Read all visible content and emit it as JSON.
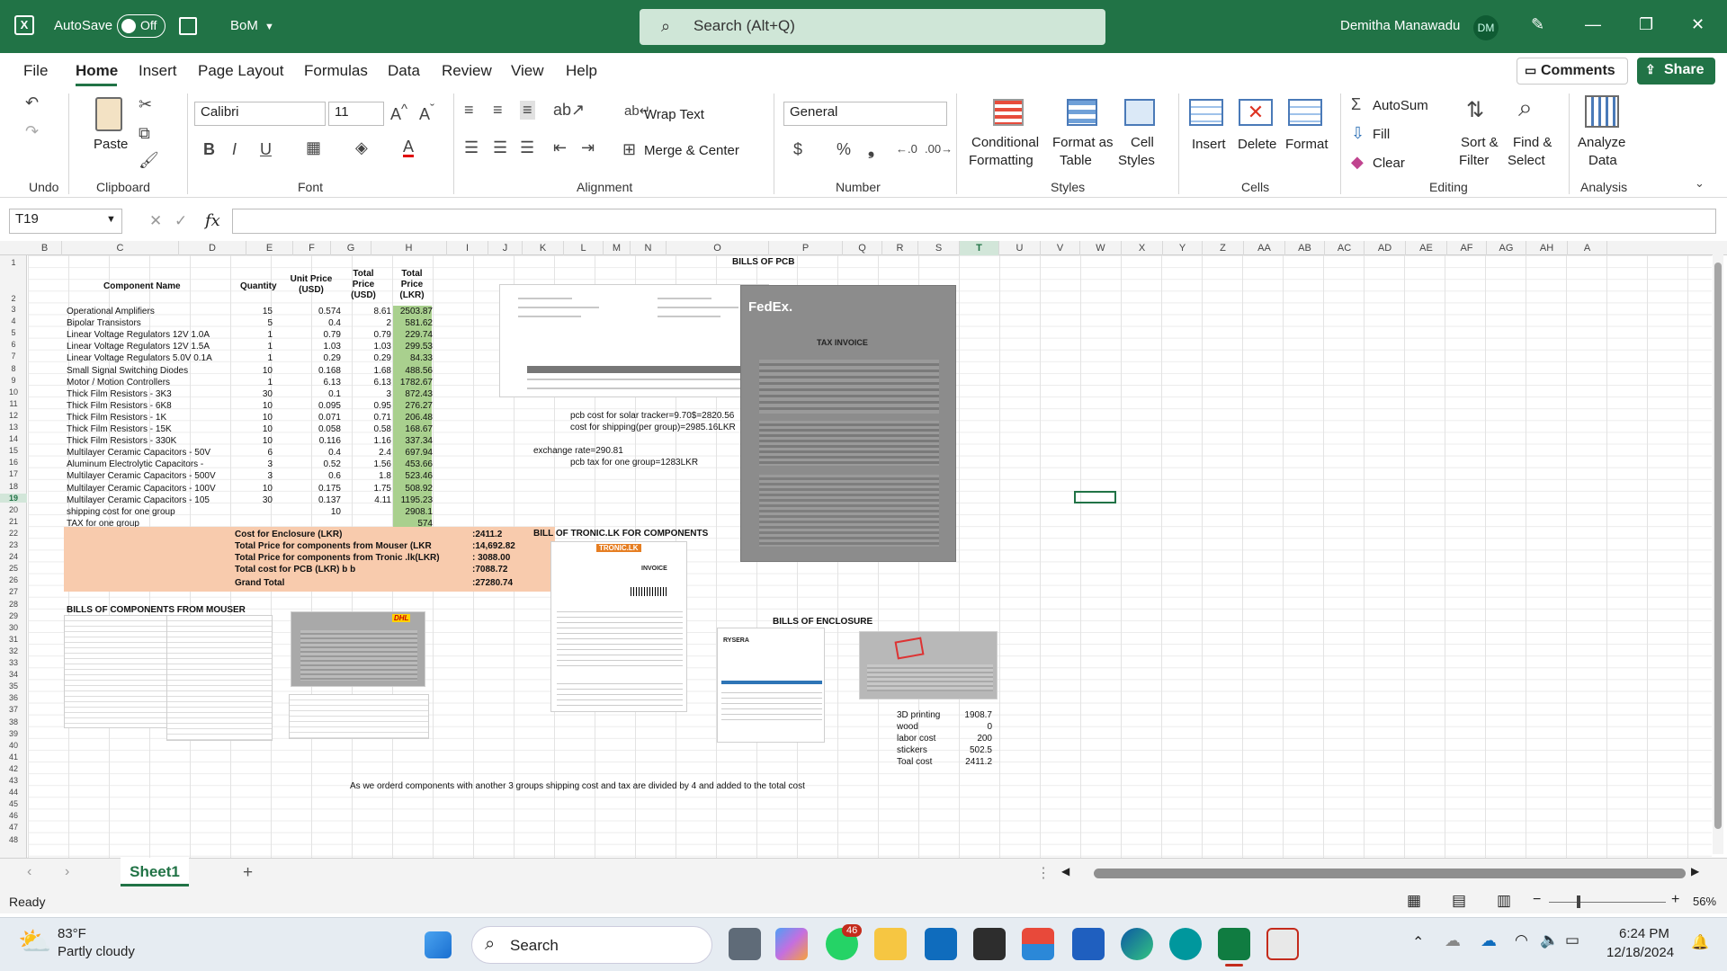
{
  "titlebar": {
    "autosave": "AutoSave",
    "autosave_state": "Off",
    "doc_name": "BoM",
    "search_placeholder": "Search (Alt+Q)",
    "user_name": "Demitha Manawadu",
    "user_initials": "DM"
  },
  "menu": {
    "file": "File",
    "home": "Home",
    "insert": "Insert",
    "page_layout": "Page Layout",
    "formulas": "Formulas",
    "data": "Data",
    "review": "Review",
    "view": "View",
    "help": "Help",
    "comments": "Comments",
    "share": "Share"
  },
  "ribbon": {
    "undo_group": "Undo",
    "paste": "Paste",
    "clipboard_group": "Clipboard",
    "font_name": "Calibri",
    "font_size": "11",
    "font_group": "Font",
    "wrap_text": "Wrap Text",
    "merge_center": "Merge & Center",
    "alignment_group": "Alignment",
    "number_format": "General",
    "number_group": "Number",
    "conditional_formatting": [
      "Conditional",
      "Formatting"
    ],
    "format_as_table": [
      "Format as",
      "Table"
    ],
    "cell_styles": [
      "Cell",
      "Styles"
    ],
    "styles_group": "Styles",
    "insert": "Insert",
    "delete": "Delete",
    "format": "Format",
    "cells_group": "Cells",
    "autosum": "AutoSum",
    "fill": "Fill",
    "clear": "Clear",
    "sort_filter": [
      "Sort &",
      "Filter"
    ],
    "find_select": [
      "Find &",
      "Select"
    ],
    "editing_group": "Editing",
    "analyze_data": [
      "Analyze",
      "Data"
    ],
    "analysis_group": "Analysis"
  },
  "formula_bar": {
    "name_box": "T19",
    "fx": "fx",
    "content": ""
  },
  "columns": [
    "B",
    "C",
    "D",
    "E",
    "F",
    "G",
    "H",
    "I",
    "J",
    "K",
    "L",
    "M",
    "N",
    "O",
    "P",
    "Q",
    "R",
    "S",
    "T",
    "U",
    "V",
    "W",
    "X",
    "Y",
    "Z",
    "AA",
    "AB",
    "AC",
    "AD",
    "AE",
    "AF",
    "AG",
    "AH",
    "A"
  ],
  "rows": [
    "1",
    "2",
    "3",
    "4",
    "5",
    "6",
    "7",
    "8",
    "9",
    "10",
    "11",
    "12",
    "13",
    "14",
    "15",
    "16",
    "17",
    "18",
    "19",
    "20",
    "21",
    "22",
    "23",
    "24",
    "25",
    "26",
    "27",
    "28",
    "29",
    "30",
    "31",
    "32",
    "33",
    "34",
    "35",
    "36",
    "37",
    "38",
    "39",
    "40",
    "41",
    "42",
    "43",
    "44",
    "45",
    "46",
    "47",
    "48"
  ],
  "sheet": {
    "title_pcb": "BILLS OF PCB",
    "headers": {
      "component": "Component Name",
      "quantity": "Quantity",
      "unit_price": "Unit Price (USD)",
      "total_usd": "Total Price (USD)",
      "total_lkr": "Total Price (LKR)"
    },
    "items": [
      {
        "name": "Operational Amplifiers",
        "qty": "15",
        "unit": "0.574",
        "usd": "8.61",
        "lkr": "2503.87"
      },
      {
        "name": "Bipolar Transistors",
        "qty": "5",
        "unit": "0.4",
        "usd": "2",
        "lkr": "581.62"
      },
      {
        "name": "Linear Voltage Regulators 12V 1.0A",
        "qty": "1",
        "unit": "0.79",
        "usd": "0.79",
        "lkr": "229.74"
      },
      {
        "name": "Linear Voltage Regulators 12V 1.5A",
        "qty": "1",
        "unit": "1.03",
        "usd": "1.03",
        "lkr": "299.53"
      },
      {
        "name": "Linear Voltage Regulators 5.0V 0.1A",
        "qty": "1",
        "unit": "0.29",
        "usd": "0.29",
        "lkr": "84.33"
      },
      {
        "name": "Small Signal Switching Diodes",
        "qty": "10",
        "unit": "0.168",
        "usd": "1.68",
        "lkr": "488.56"
      },
      {
        "name": "Motor / Motion Controllers",
        "qty": "1",
        "unit": "6.13",
        "usd": "6.13",
        "lkr": "1782.67"
      },
      {
        "name": "Thick Film Resistors - 3K3",
        "qty": "30",
        "unit": "0.1",
        "usd": "3",
        "lkr": "872.43"
      },
      {
        "name": "Thick Film Resistors - 6K8",
        "qty": "10",
        "unit": "0.095",
        "usd": "0.95",
        "lkr": "276.27"
      },
      {
        "name": "Thick Film Resistors - 1K",
        "qty": "10",
        "unit": "0.071",
        "usd": "0.71",
        "lkr": "206.48"
      },
      {
        "name": "Thick Film Resistors - 15K",
        "qty": "10",
        "unit": "0.058",
        "usd": "0.58",
        "lkr": "168.67"
      },
      {
        "name": "Thick Film Resistors - 330K",
        "qty": "10",
        "unit": "0.116",
        "usd": "1.16",
        "lkr": "337.34"
      },
      {
        "name": "Multilayer Ceramic Capacitors - 50V",
        "qty": "6",
        "unit": "0.4",
        "usd": "2.4",
        "lkr": "697.94"
      },
      {
        "name": "Aluminum Electrolytic Capacitors -",
        "qty": "3",
        "unit": "0.52",
        "usd": "1.56",
        "lkr": "453.66"
      },
      {
        "name": "Multilayer Ceramic Capacitors - 500V",
        "qty": "3",
        "unit": "0.6",
        "usd": "1.8",
        "lkr": "523.46"
      },
      {
        "name": "Multilayer Ceramic Capacitors - 100V",
        "qty": "10",
        "unit": "0.175",
        "usd": "1.75",
        "lkr": "508.92"
      },
      {
        "name": "Multilayer Ceramic Capacitors - 105",
        "qty": "30",
        "unit": "0.137",
        "usd": "4.11",
        "lkr": "1195.23"
      },
      {
        "name": "shipping cost for one group",
        "qty": "",
        "unit": "10",
        "usd": "",
        "lkr": "2908.1"
      },
      {
        "name": "TAX for one group",
        "qty": "",
        "unit": "",
        "usd": "",
        "lkr": "574"
      }
    ],
    "summary": [
      {
        "label": "Cost for Enclosure (LKR)",
        "value": ":2411.2"
      },
      {
        "label": "Total Price for components from Mouser (LKR",
        "value": ":14,692.82"
      },
      {
        "label": "Total Price for components from Tronic .lk(LKR)",
        "value": ": 3088.00"
      },
      {
        "label": "Total cost for PCB (LKR)  b b",
        "value": ":7088.72"
      },
      {
        "label": "Grand Total",
        "value": ":27280.74"
      }
    ],
    "pcb_notes": [
      "pcb cost for solar tracker=9.70$=2820.56",
      "cost for shipping(per group)=2985.16LKR",
      "exchange rate=290.81",
      "pcb tax for one group=1283LKR"
    ],
    "title_mouser": "BILLS OF COMPONENTS FROM MOUSER",
    "title_tronic": "BILL OF TRONIC.LK FOR COMPONENTS",
    "title_enclosure": "BILLS  OF ENCLOSURE",
    "enclosure": [
      {
        "label": "3D printing",
        "value": "1908.7"
      },
      {
        "label": "wood",
        "value": "0"
      },
      {
        "label": "labor cost",
        "value": "200"
      },
      {
        "label": "stickers",
        "value": "502.5"
      },
      {
        "label": "Toal cost",
        "value": "2411.2"
      }
    ],
    "footnote": "As we orderd components with another 3 groups shipping cost and tax are divided by 4 and added to the total cost",
    "image_labels": {
      "fedex": "FedEx.",
      "dhl": "DHL",
      "tronic": "TRONIC.LK",
      "invoice": "INVOICE",
      "rysera": "RYSERA",
      "tax_invoice": "TAX INVOICE"
    }
  },
  "sheet_tabs": {
    "active": "Sheet1",
    "add": "+"
  },
  "status": {
    "ready": "Ready",
    "zoom": "56%"
  },
  "taskbar": {
    "temp": "83°F",
    "weather": "Partly cloudy",
    "search": "Search",
    "badge": "46",
    "time": "6:24 PM",
    "date": "12/18/2024"
  },
  "colors": {
    "excel_green": "#217346",
    "summary_fill": "#f8cbad",
    "lkr_fill": "#a9d08e"
  }
}
